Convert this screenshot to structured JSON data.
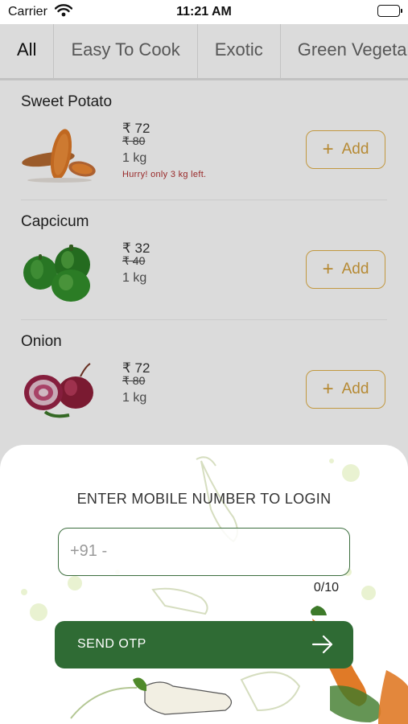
{
  "statusbar": {
    "carrier": "Carrier",
    "time": "11:21 AM"
  },
  "tabs": [
    {
      "label": "All"
    },
    {
      "label": "Easy To Cook"
    },
    {
      "label": "Exotic"
    },
    {
      "label": "Green Vegetables"
    }
  ],
  "products": [
    {
      "name": "Sweet Potato",
      "price": "₹ 72",
      "mrp": "₹ 80",
      "quantity": "1 kg",
      "stock_note": "Hurry! only 3 kg left.",
      "add_label": "Add"
    },
    {
      "name": "Capcicum",
      "price": "₹ 32",
      "mrp": "₹ 40",
      "quantity": "1 kg",
      "add_label": "Add"
    },
    {
      "name": "Onion",
      "price": "₹ 72",
      "mrp": "₹ 80",
      "quantity": "1 kg",
      "add_label": "Add"
    }
  ],
  "login": {
    "title": "ENTER MOBILE NUMBER TO LOGIN",
    "phone_placeholder": "+91 -",
    "phone_value": "",
    "char_counter": "0/10",
    "send_otp_label": "SEND OTP"
  },
  "colors": {
    "brand_green": "#2f6b34",
    "accent_gold": "#e2b24a",
    "alert_red": "#b23030"
  }
}
